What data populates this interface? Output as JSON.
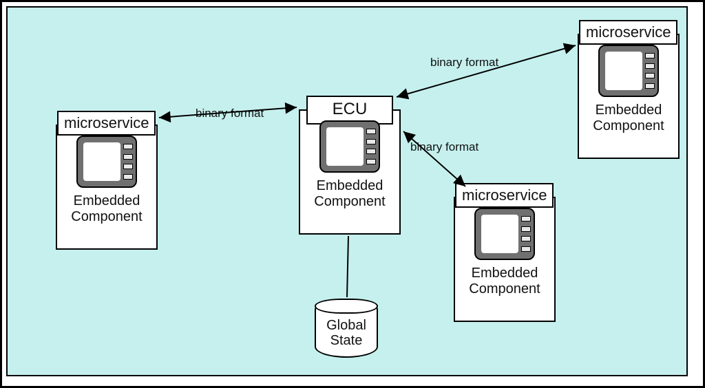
{
  "nodes": {
    "ecu": {
      "title": "ECU",
      "caption": "Embedded\nComponent"
    },
    "ms_left": {
      "title": "microservice",
      "caption": "Embedded\nComponent"
    },
    "ms_tr": {
      "title": "microservice",
      "caption": "Embedded\nComponent"
    },
    "ms_br": {
      "title": "microservice",
      "caption": "Embedded\nComponent"
    },
    "db": {
      "label": "Global\nState"
    }
  },
  "edges": {
    "left": {
      "label": "binary format"
    },
    "tr": {
      "label": "binary format"
    },
    "br": {
      "label": "binary format"
    }
  }
}
